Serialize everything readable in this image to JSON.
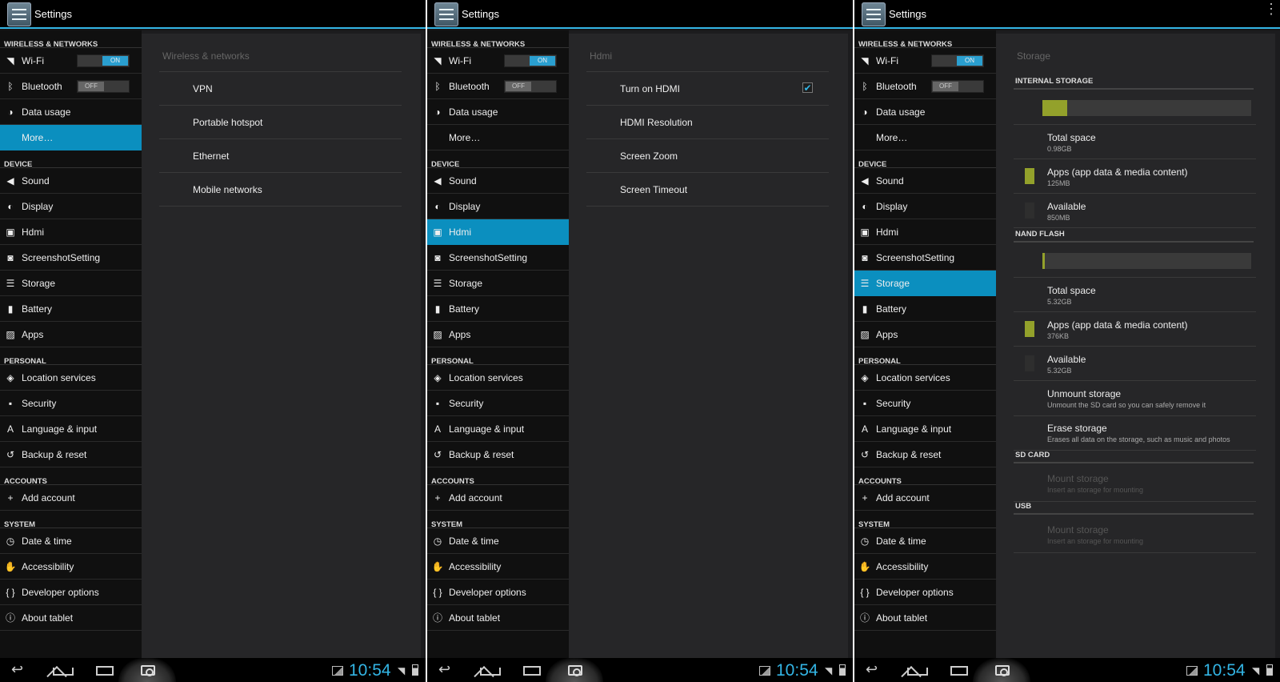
{
  "app_title": "Settings",
  "status_time": "10:54",
  "colors": {
    "accent": "#0b8fbf",
    "holo_blue": "#33b5e5",
    "storage_used": "#93a12b"
  },
  "nav_sections": [
    {
      "header": "WIRELESS & NETWORKS",
      "items": [
        {
          "key": "wifi",
          "label": "Wi-Fi",
          "icon": "wifi-icon",
          "toggle": "ON"
        },
        {
          "key": "bluetooth",
          "label": "Bluetooth",
          "icon": "bluetooth-icon",
          "toggle": "OFF"
        },
        {
          "key": "data-usage",
          "label": "Data usage",
          "icon": "data-usage-icon"
        },
        {
          "key": "more",
          "label": "More…",
          "icon": ""
        }
      ]
    },
    {
      "header": "DEVICE",
      "items": [
        {
          "key": "sound",
          "label": "Sound",
          "icon": "speaker-icon"
        },
        {
          "key": "display",
          "label": "Display",
          "icon": "brightness-icon"
        },
        {
          "key": "hdmi",
          "label": "Hdmi",
          "icon": "hdmi-icon"
        },
        {
          "key": "screenshot",
          "label": "ScreenshotSetting",
          "icon": "camera-icon"
        },
        {
          "key": "storage",
          "label": "Storage",
          "icon": "storage-icon"
        },
        {
          "key": "battery",
          "label": "Battery",
          "icon": "battery-icon"
        },
        {
          "key": "apps",
          "label": "Apps",
          "icon": "apps-icon"
        }
      ]
    },
    {
      "header": "PERSONAL",
      "items": [
        {
          "key": "location",
          "label": "Location services",
          "icon": "location-icon"
        },
        {
          "key": "security",
          "label": "Security",
          "icon": "lock-icon"
        },
        {
          "key": "language",
          "label": "Language & input",
          "icon": "keyboard-icon"
        },
        {
          "key": "backup",
          "label": "Backup & reset",
          "icon": "backup-icon"
        }
      ]
    },
    {
      "header": "ACCOUNTS",
      "items": [
        {
          "key": "add-account",
          "label": "Add account",
          "icon": "plus-icon"
        }
      ]
    },
    {
      "header": "SYSTEM",
      "items": [
        {
          "key": "date-time",
          "label": "Date & time",
          "icon": "clock-icon"
        },
        {
          "key": "accessibility",
          "label": "Accessibility",
          "icon": "hand-icon"
        },
        {
          "key": "developer",
          "label": "Developer options",
          "icon": "braces-icon"
        },
        {
          "key": "about",
          "label": "About tablet",
          "icon": "info-icon"
        }
      ]
    }
  ],
  "screens": [
    {
      "active": "more",
      "overflow_menu": false,
      "pane": {
        "title": "Wireless & networks",
        "items": [
          "VPN",
          "Portable hotspot",
          "Ethernet",
          "Mobile networks"
        ]
      }
    },
    {
      "active": "hdmi",
      "overflow_menu": false,
      "pane": {
        "title": "Hdmi",
        "items": [
          "Turn on HDMI",
          "HDMI Resolution",
          "Screen Zoom",
          "Screen Timeout"
        ],
        "checked": [
          true,
          false,
          false,
          false
        ]
      }
    },
    {
      "active": "storage",
      "overflow_menu": true,
      "pane": {
        "title": "Storage",
        "internal": {
          "header": "INTERNAL STORAGE",
          "used_fraction": 0.12,
          "total_label": "Total space",
          "total_value": "0.98GB",
          "apps_label": "Apps (app data & media content)",
          "apps_value": "125MB",
          "avail_label": "Available",
          "avail_value": "850MB"
        },
        "nand": {
          "header": "NAND FLASH",
          "used_fraction": 0.01,
          "total_label": "Total space",
          "total_value": "5.32GB",
          "apps_label": "Apps (app data & media content)",
          "apps_value": "376KB",
          "avail_label": "Available",
          "avail_value": "5.32GB"
        },
        "unmount_label": "Unmount storage",
        "unmount_sub": "Unmount the SD card so you can safely remove it",
        "erase_label": "Erase storage",
        "erase_sub": "Erases all data on the storage, such as music and photos",
        "sd": {
          "header": "SD CARD",
          "label": "Mount storage",
          "sub": "Insert an storage for mounting"
        },
        "usb": {
          "header": "USB",
          "label": "Mount storage",
          "sub": "Insert an storage for mounting"
        }
      }
    }
  ]
}
